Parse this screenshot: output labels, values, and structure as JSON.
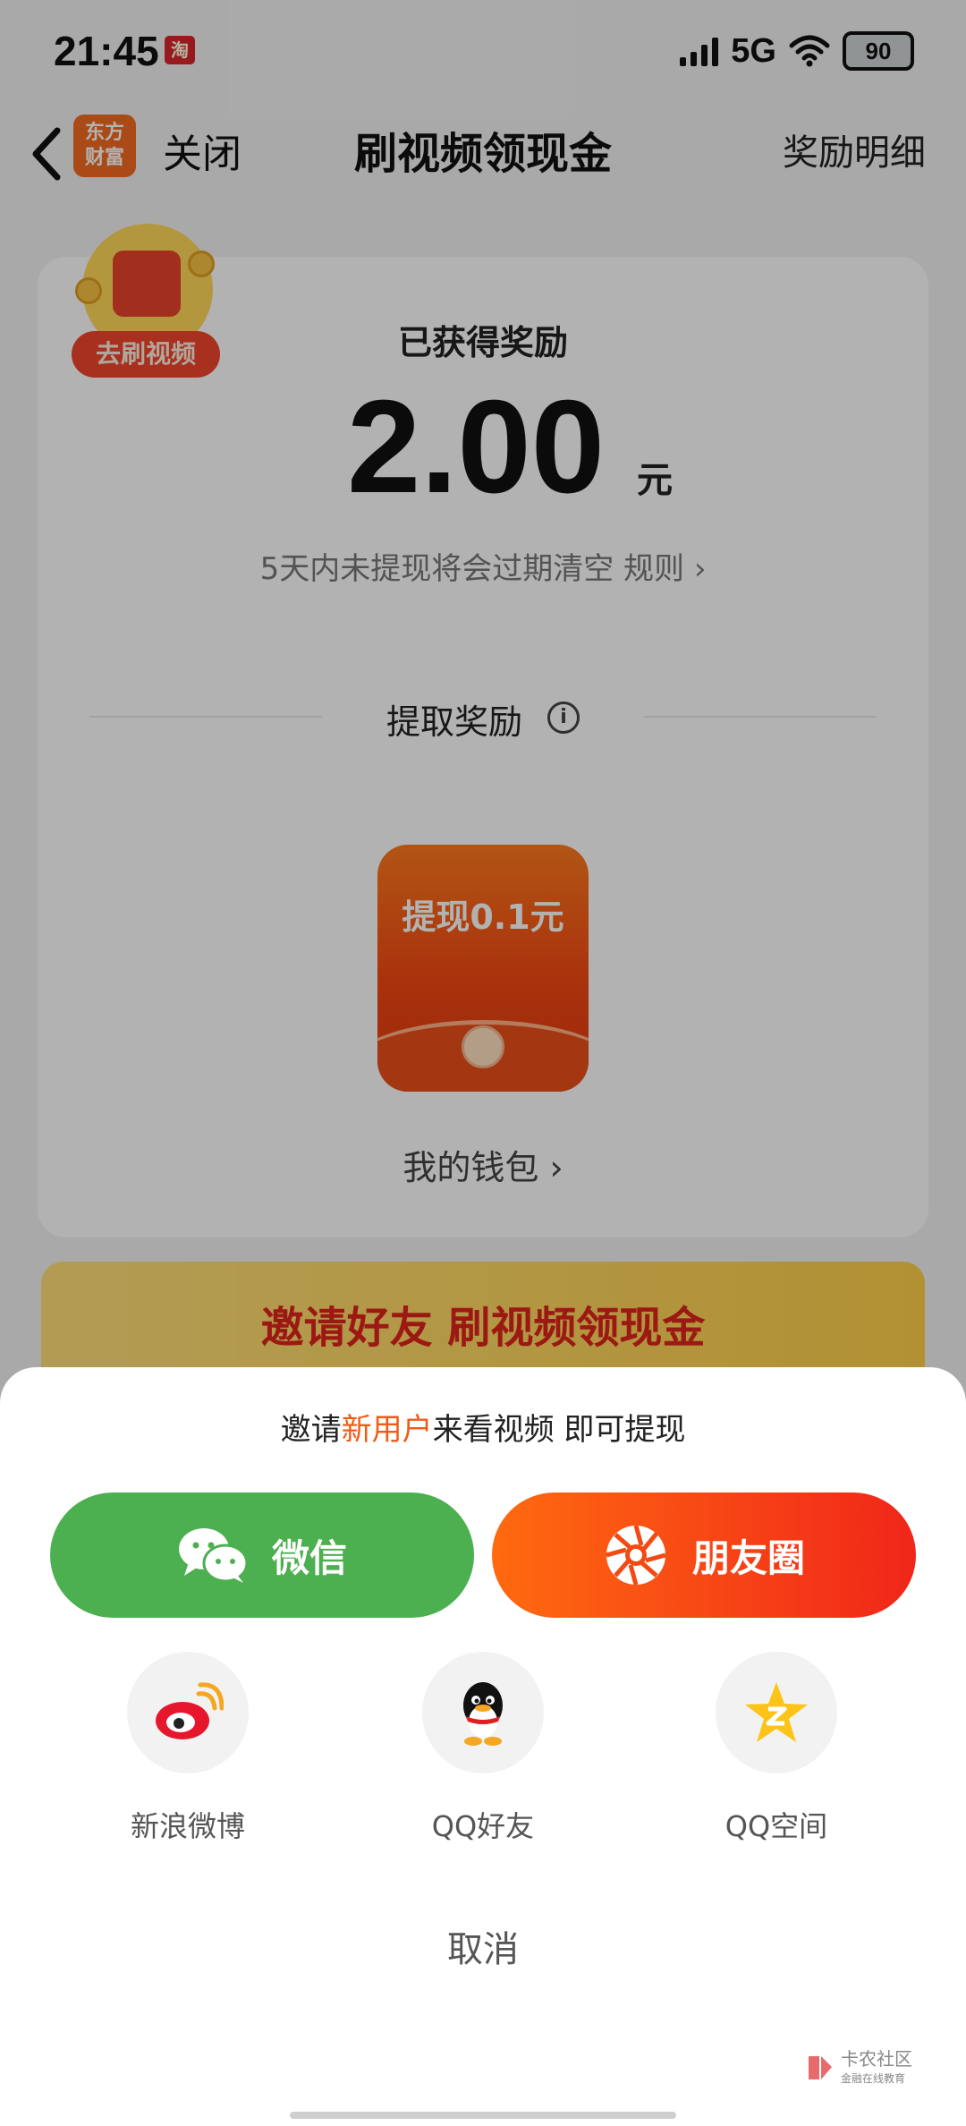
{
  "status_bar": {
    "time": "21:45",
    "network": "5G",
    "battery": "90"
  },
  "nav": {
    "logo_line1": "东方",
    "logo_line2": "财富",
    "close": "关闭",
    "title": "刷视频领现金",
    "reward_detail": "奖励明细"
  },
  "reward_card": {
    "video_badge": "去刷视频",
    "earned_label": "已获得奖励",
    "amount": "2.00",
    "unit": "元",
    "expire_notice": "5天内未提现将会过期清空 规则 ›",
    "withdraw_title": "提取奖励",
    "packet_label": "提现0.1元",
    "wallet_link": "我的钱包 ›"
  },
  "banner": {
    "text": "邀请好友 刷视频领现金"
  },
  "share_sheet": {
    "prompt_before": "邀请",
    "prompt_highlight": "新用户",
    "prompt_after": "来看视频 即可提现",
    "wechat": "微信",
    "moments": "朋友圈",
    "items": [
      {
        "label": "新浪微博",
        "icon": "weibo-icon"
      },
      {
        "label": "QQ好友",
        "icon": "qq-icon"
      },
      {
        "label": "QQ空间",
        "icon": "qzone-icon"
      }
    ],
    "cancel": "取消"
  },
  "watermark": {
    "line1": "卡农社区",
    "line2": "金融在线教育"
  },
  "colors": {
    "accent": "#f35a16",
    "wechat_green": "#4caf50",
    "moments_red": "#f0261a"
  }
}
